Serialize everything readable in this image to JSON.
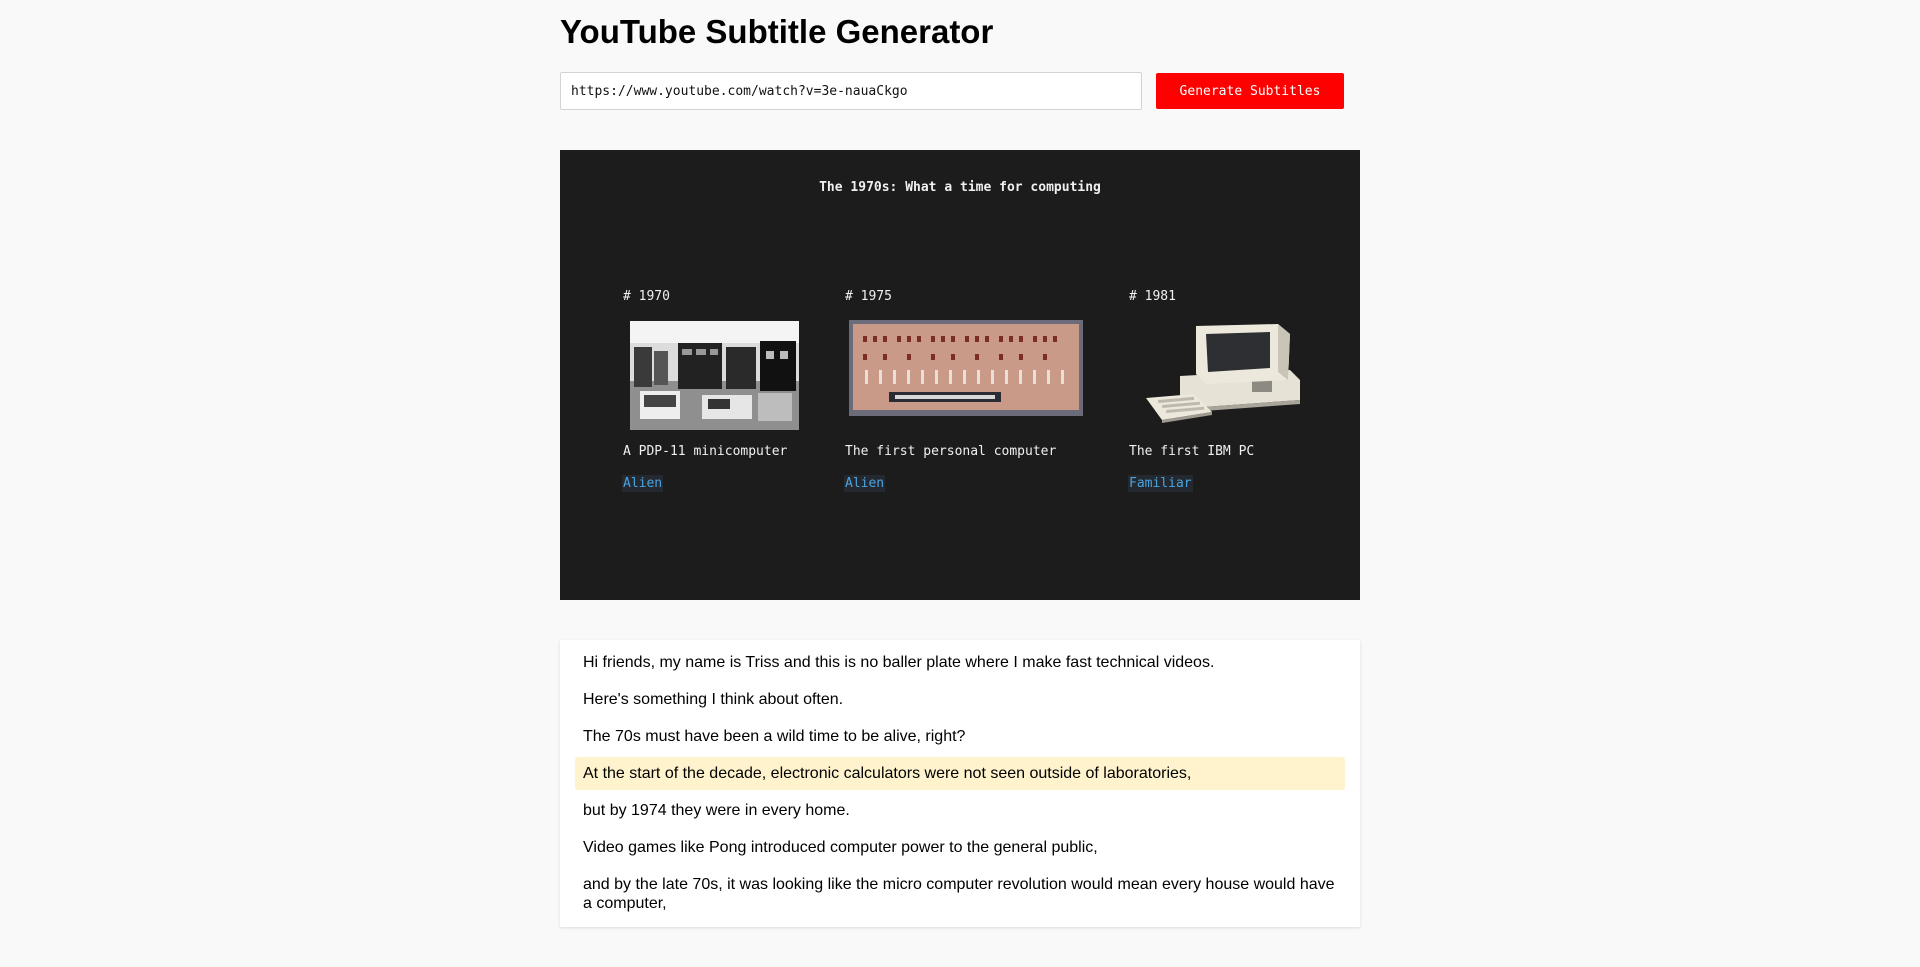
{
  "page": {
    "title": "YouTube Subtitle Generator",
    "url_value": "https://www.youtube.com/watch?v=3e-nauaCkgo",
    "generate_label": "Generate Subtitles"
  },
  "video": {
    "slide_title": "The 1970s: What a time for computing",
    "items": [
      {
        "year": "# 1970",
        "caption": "A PDP-11 minicomputer",
        "tag": "Alien",
        "image": "pdp11-room-photo"
      },
      {
        "year": "# 1975",
        "caption": "The first personal computer",
        "tag": "Alien",
        "image": "altair-8800-front-panel"
      },
      {
        "year": "# 1981",
        "caption": "The first IBM PC",
        "tag": "Familiar",
        "image": "ibm-pc-with-keyboard"
      }
    ]
  },
  "subtitles": {
    "active_index": 3,
    "lines": [
      "Hi friends, my name is Triss and this is no baller plate where I make fast technical videos.",
      "Here's something I think about often.",
      "The 70s must have been a wild time to be alive, right?",
      "At the start of the decade, electronic calculators were not seen outside of laboratories,",
      "but by 1974 they were in every home.",
      "Video games like Pong introduced computer power to the general public,",
      "and by the late 70s, it was looking like the micro computer revolution would mean every house would have a computer,"
    ]
  },
  "colors": {
    "accent": "#ff0000",
    "video_bg": "#1c1c1c",
    "tag_text": "#4aa3e0",
    "active_highlight": "#fff3cd"
  }
}
